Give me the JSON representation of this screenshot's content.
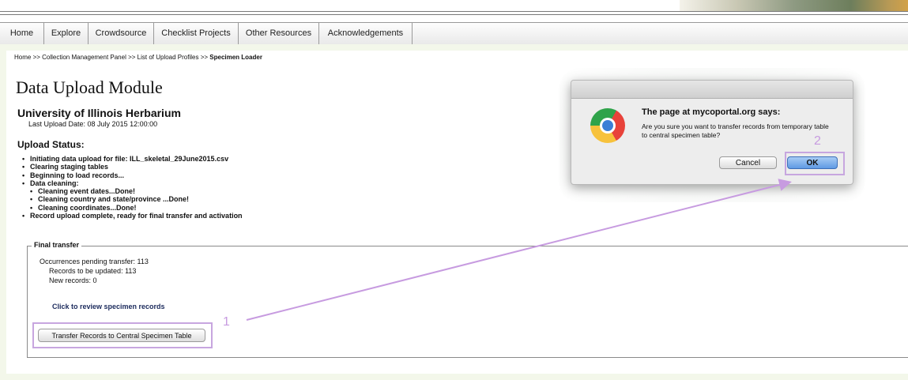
{
  "nav": {
    "items": [
      "Home",
      "Explore",
      "Crowdsource",
      "Checklist Projects",
      "Other Resources",
      "Acknowledgements"
    ]
  },
  "breadcrumb": {
    "part1": "Home >> Collection Management Panel >> List of Upload Profiles >> ",
    "current": "Specimen Loader"
  },
  "page": {
    "title": "Data Upload Module",
    "institution": "University of Illinois Herbarium",
    "last_upload": "Last Upload Date: 08 July 2015 12:00:00",
    "upload_status_heading": "Upload Status:",
    "status_items": [
      "Initiating data upload for file: ILL_skeletal_29June2015.csv",
      "Clearing staging tables",
      "Beginning to load records...",
      "Data cleaning:",
      "Cleaning event dates...Done!",
      "Cleaning country and state/province ...Done!",
      "Cleaning coordinates...Done!",
      "Record upload complete, ready for final transfer and activation"
    ]
  },
  "final_transfer": {
    "legend": "Final transfer",
    "pending": "Occurrences pending transfer: 113",
    "updated": "Records to be updated: 113",
    "new": "New records: 0",
    "review_link": "Click to review specimen records",
    "transfer_button": "Transfer Records to Central Specimen Table"
  },
  "dialog": {
    "title": "The page at mycoportal.org says:",
    "message": "Are you sure you want to transfer records from temporary table to central specimen table?",
    "cancel": "Cancel",
    "ok": "OK",
    "icon": "chrome-icon"
  },
  "annotations": {
    "step1": "1",
    "step2": "2",
    "color": "#c79be0"
  }
}
